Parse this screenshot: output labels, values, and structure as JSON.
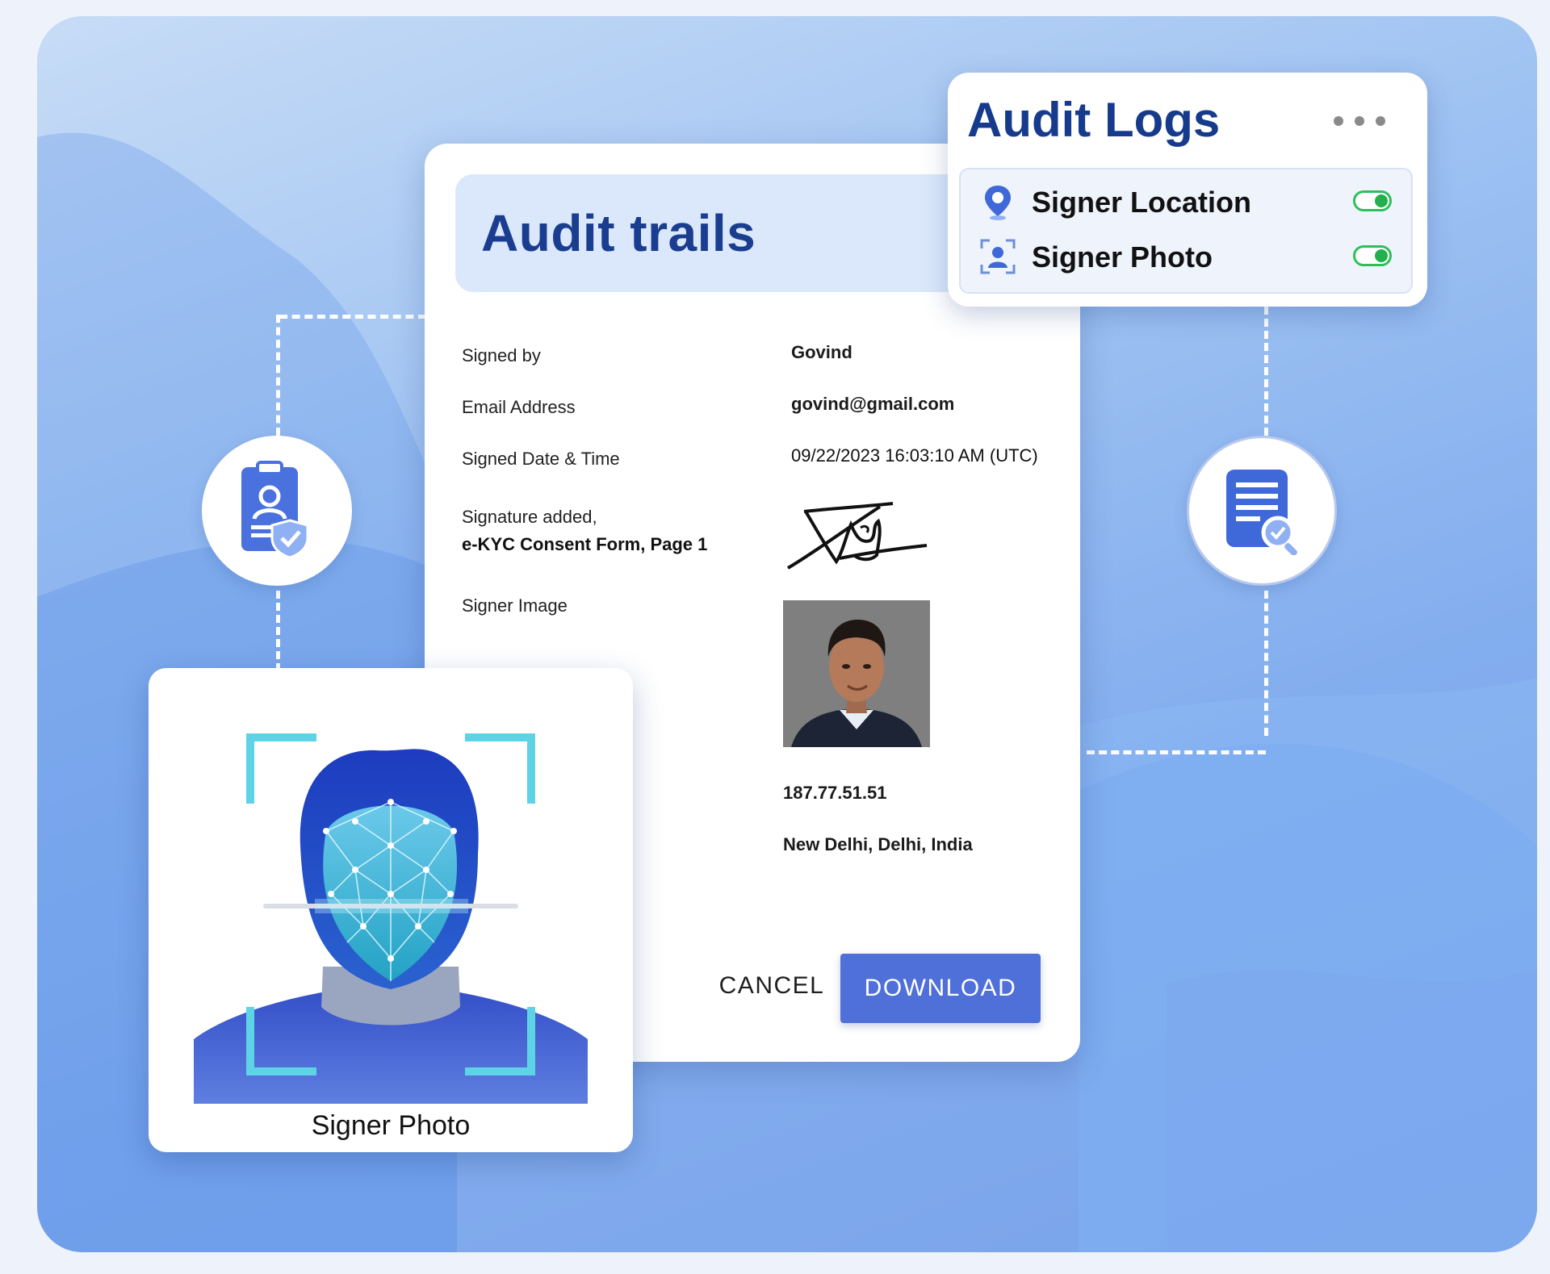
{
  "colors": {
    "accent": "#4f6fd9",
    "title_blue": "#1a3d8f",
    "toggle_on": "#22b04e",
    "header_tint": "#dbe8fb"
  },
  "audit_trails": {
    "title": "Audit trails",
    "rows": [
      {
        "label": "Signed by",
        "value": "Govind"
      },
      {
        "label": "Email Address",
        "value": "govind@gmail.com"
      },
      {
        "label": "Signed Date & Time",
        "value": "09/22/2023 16:03:10  AM (UTC)"
      },
      {
        "label": "Signature added,",
        "label_bold": "e-KYC Consent Form, Page 1",
        "value_type": "signature"
      },
      {
        "label": "Signer Image",
        "value_type": "photo"
      }
    ],
    "ip_address": "187.77.51.51",
    "location": "New Delhi, Delhi, India",
    "cancel_label": "CANCEL",
    "download_label": "DOWNLOAD"
  },
  "audit_logs": {
    "title": "Audit Logs",
    "menu_icon": "more-horizontal-icon",
    "items": [
      {
        "label": "Signer Location",
        "icon": "location-pin-icon",
        "enabled": true
      },
      {
        "label": "Signer Photo",
        "icon": "user-frame-icon",
        "enabled": true
      }
    ]
  },
  "signer_photo_card": {
    "label": "Signer Photo",
    "icon": "face-scan-icon"
  },
  "side_icons": {
    "left": "id-badge-shield-icon",
    "right": "document-search-icon"
  }
}
